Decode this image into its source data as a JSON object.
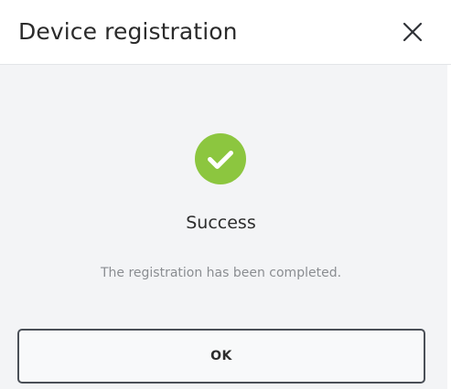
{
  "dialog": {
    "title": "Device registration",
    "close_icon": "close-icon",
    "colors": {
      "header_background": "#ffffff",
      "body_background": "#f3f4f6",
      "success_accent": "#8cc63f",
      "button_border": "#4a4f57"
    }
  },
  "result": {
    "icon": "check-circle-icon",
    "heading": "Success",
    "message": "The registration has been completed."
  },
  "actions": {
    "ok_label": "OK"
  }
}
